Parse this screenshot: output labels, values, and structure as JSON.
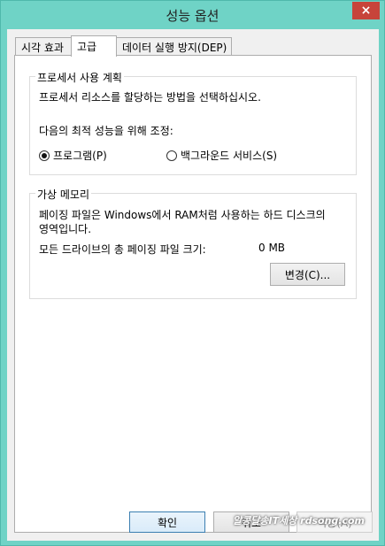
{
  "window": {
    "title": "성능 옵션",
    "close_icon": "×"
  },
  "tabs": [
    {
      "label": "시각 효과"
    },
    {
      "label": "고급"
    },
    {
      "label": "데이터 실행 방지(DEP)"
    }
  ],
  "processor_scheduling": {
    "title": "프로세서 사용 계획",
    "description": "프로세서 리소스를 할당하는 방법을 선택하십시오.",
    "adjust_label": "다음의 최적 성능을 위해 조정:",
    "options": [
      {
        "label": "프로그램(P)",
        "checked": true
      },
      {
        "label": "백그라운드 서비스(S)",
        "checked": false
      }
    ]
  },
  "virtual_memory": {
    "title": "가상 메모리",
    "description_line1": "페이징 파일은 Windows에서 RAM처럼 사용하는 하드 디스크의",
    "description_line2": "영역입니다.",
    "total_label": "모든 드라이브의 총 페이징 파일 크기:",
    "total_value": "0 MB",
    "change_button": "변경(C)..."
  },
  "footer": {
    "ok_button": "확인",
    "cancel_button": "취소",
    "apply_button": "적용(A)",
    "watermark": "알콩달송IT세상 rdsong.com"
  }
}
